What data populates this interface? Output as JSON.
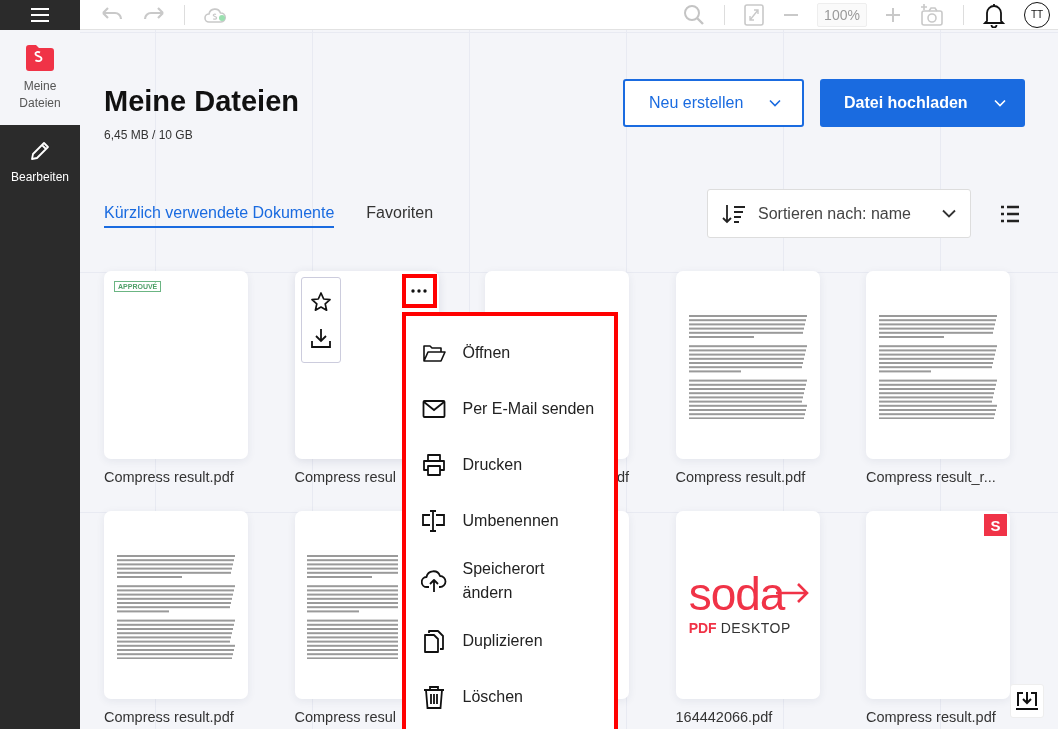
{
  "sidebar": {
    "items": [
      {
        "label": "Meine Dateien",
        "kind": "folder",
        "selected": true
      },
      {
        "label": "Bearbeiten",
        "kind": "pencil",
        "selected": false
      }
    ]
  },
  "toolbar": {
    "zoom": {
      "value": "100%",
      "disabled": true
    },
    "avatar": "TT"
  },
  "header": {
    "title": "Meine Dateien",
    "storage": "6,45 MB / 10 GB"
  },
  "buttons": [
    {
      "label": "Neu erstellen",
      "kind": "outline"
    },
    {
      "label": "Datei hochladen",
      "kind": "primary"
    }
  ],
  "tabs": [
    {
      "label": "Kürzlich verwendete Dokumente",
      "selected": true
    },
    {
      "label": "Favoriten",
      "selected": false
    }
  ],
  "sort": {
    "label": "Sortieren nach: name"
  },
  "files": [
    {
      "name": "Compress result.pdf",
      "kind": "stamp",
      "stamp": "APPROUVÉ",
      "hovered": false
    },
    {
      "name": "Compress resul",
      "kind": "blank",
      "hovered": true,
      "menu_open": true
    },
    {
      "name": "df",
      "name_clipped": true,
      "kind": "blank",
      "hovered": false
    },
    {
      "name": "Compress result.pdf",
      "kind": "text",
      "hovered": false
    },
    {
      "name": "Compress result_r...",
      "kind": "text",
      "hovered": false
    },
    {
      "name": "Compress result.pdf",
      "kind": "text",
      "hovered": false
    },
    {
      "name": "Compress resul",
      "kind": "text",
      "hovered": false
    },
    {
      "kind": "blank",
      "hovered": false
    },
    {
      "name": "164442066.pdf",
      "kind": "logo",
      "logo": {
        "word": "soda",
        "sub_1": "PDF",
        "sub_2": "DESKTOP"
      },
      "hovered": false
    },
    {
      "name": "Compress result.pdf",
      "kind": "badge",
      "badge": "S",
      "hovered": false
    }
  ],
  "context_menu": {
    "items": [
      {
        "label": "Öffnen",
        "kind": "open"
      },
      {
        "label": "Per E-Mail senden",
        "kind": "mail"
      },
      {
        "label": "Drucken",
        "kind": "print"
      },
      {
        "label": "Umbenennen",
        "kind": "rename"
      },
      {
        "label": "Speicherort ändern",
        "kind": "move"
      },
      {
        "label": "Duplizieren",
        "kind": "duplicate"
      },
      {
        "label": "Löschen",
        "kind": "delete"
      }
    ]
  }
}
